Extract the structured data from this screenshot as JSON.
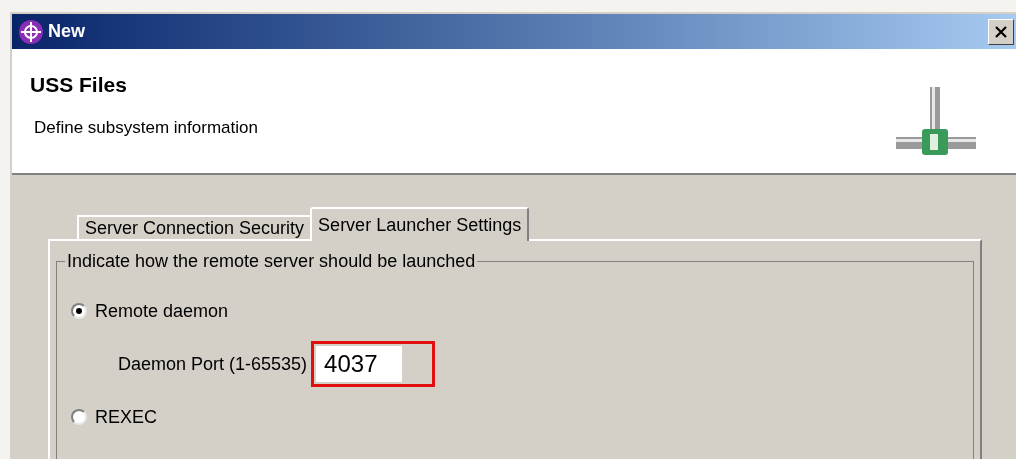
{
  "window": {
    "title": "New"
  },
  "header": {
    "title": "USS Files",
    "description": "Define subsystem information"
  },
  "tabs": [
    {
      "label": "Server Connection Security",
      "selected": false
    },
    {
      "label": "Server Launcher Settings",
      "selected": true
    }
  ],
  "group": {
    "label": "Indicate how the remote server should be launched",
    "options": [
      {
        "kind": "radio",
        "label": "Remote daemon",
        "selected": true
      },
      {
        "kind": "port",
        "label": "Daemon Port (1-65535)",
        "value": "4037",
        "highlighted": true
      },
      {
        "kind": "radio",
        "label": "REXEC",
        "selected": false
      }
    ]
  }
}
